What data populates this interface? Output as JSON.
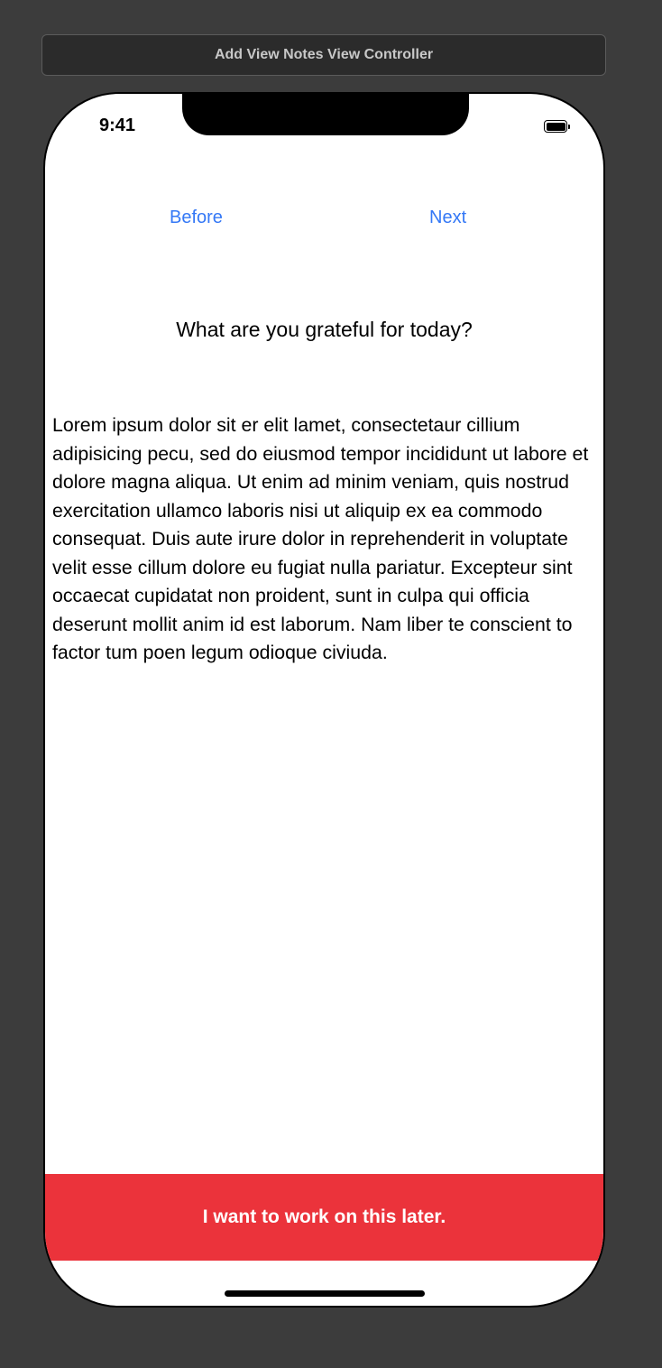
{
  "window": {
    "title": "Add View Notes View Controller"
  },
  "status_bar": {
    "time": "9:41",
    "battery_icon": "battery-full-icon"
  },
  "nav": {
    "before_label": "Before",
    "next_label": "Next",
    "link_color": "#3478f6"
  },
  "prompt": {
    "question": "What are you grateful for today?"
  },
  "notes": {
    "text": "Lorem ipsum dolor sit er elit lamet, consectetaur cillium adipisicing pecu, sed do eiusmod tempor incididunt ut labore et dolore magna aliqua. Ut enim ad minim veniam, quis nostrud exercitation ullamco laboris nisi ut aliquip ex ea commodo consequat. Duis aute irure dolor in reprehenderit in voluptate velit esse cillum dolore eu fugiat nulla pariatur. Excepteur sint occaecat cupidatat non proident, sunt in culpa qui officia deserunt mollit anim id est laborum. Nam liber te conscient to factor tum poen legum odioque civiuda."
  },
  "actions": {
    "later_label": "I want to work on this later.",
    "later_color": "#eb333b"
  }
}
